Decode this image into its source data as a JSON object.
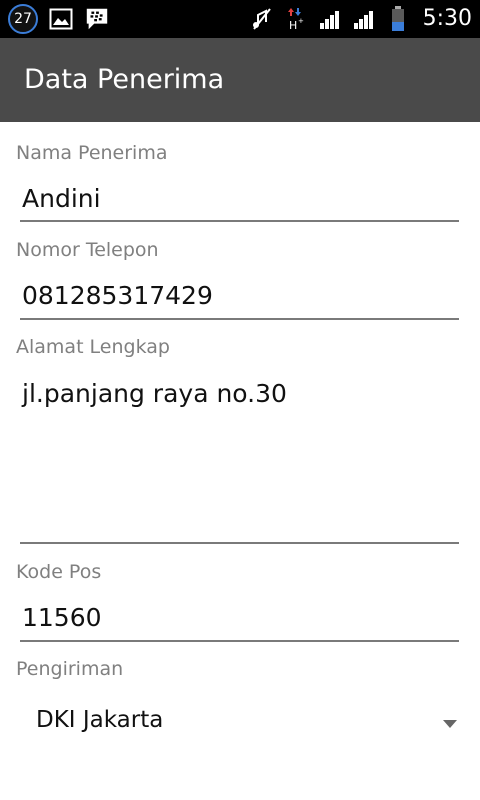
{
  "status_bar": {
    "notification_count": "27",
    "time": "5:30",
    "icons": [
      "notification-count-badge",
      "gallery-icon",
      "bbm-icon",
      "mute-icon",
      "hspa-data-icon",
      "signal-icon",
      "signal-icon",
      "battery-icon"
    ]
  },
  "app_bar": {
    "title": "Data Penerima"
  },
  "form": {
    "nama": {
      "label": "Nama Penerima",
      "value": "Andini"
    },
    "telepon": {
      "label": "Nomor Telepon",
      "value": "081285317429"
    },
    "alamat": {
      "label": "Alamat Lengkap",
      "value": "jl.panjang raya no.30"
    },
    "kode_pos": {
      "label": "Kode Pos",
      "value": "11560"
    },
    "pengiriman": {
      "label": "Pengiriman",
      "selected": "DKI Jakarta"
    }
  },
  "colors": {
    "status_bar_bg": "#000000",
    "app_bar_bg": "#4a4a4a",
    "label_text": "#808080",
    "value_text": "#111111",
    "underline": "#7a7a7a"
  }
}
